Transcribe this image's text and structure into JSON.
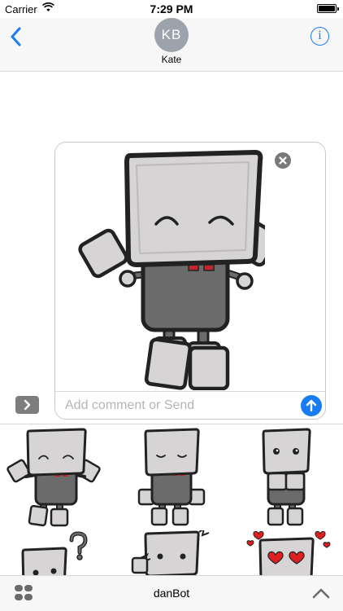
{
  "status_bar": {
    "carrier": "Carrier",
    "time": "7:29 PM"
  },
  "header": {
    "avatar_initials": "KB",
    "contact_name": "Kate",
    "info_icon": "i"
  },
  "compose": {
    "placeholder": "Add comment or Send",
    "value": ""
  },
  "bottom_bar": {
    "app_name": "danBot"
  },
  "colors": {
    "accent": "#1a7cf5",
    "robot_body": "#6b6b6b",
    "robot_head": "#d6d4d4",
    "heart": "#e02020"
  },
  "icons": [
    "wifi-icon",
    "battery-icon",
    "back-chevron-icon",
    "info-icon",
    "expand-chevron-icon",
    "close-icon",
    "send-arrow-icon",
    "apps-grid-icon",
    "chevron-up-icon"
  ]
}
